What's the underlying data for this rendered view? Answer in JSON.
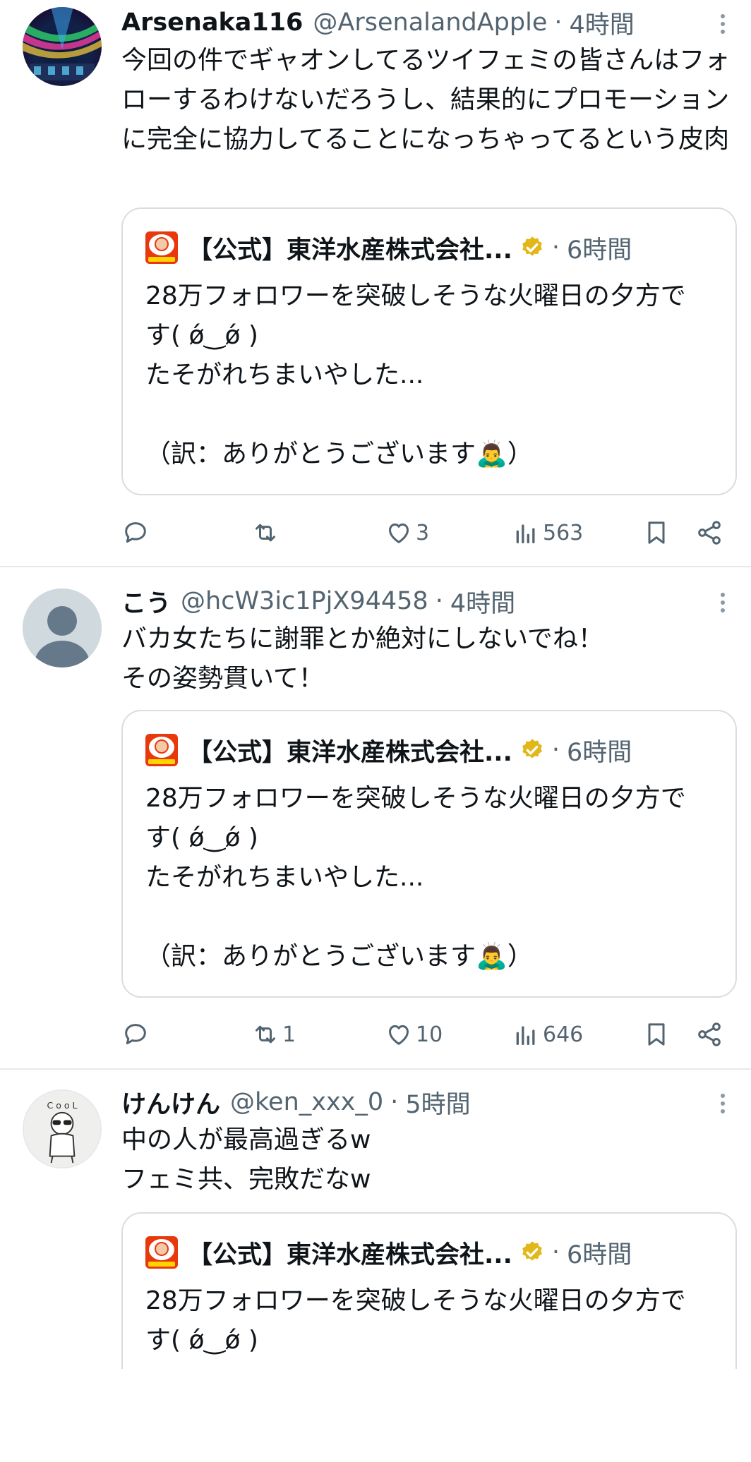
{
  "tweets": [
    {
      "name": "Arsenaka116",
      "handle": "@ArsenalandApple",
      "time": "4時間",
      "text": "今回の件でギャオンしてるツイフェミの皆さんはフォローするわけないだろうし、結果的にプロモーションに完全に協力してることになっちゃってるという皮肉",
      "avatar_icon": "neon-photo-avatar",
      "quote": {
        "name": "【公式】東洋水産株式会社...",
        "time": "6時間",
        "text": "28万フォロワーを突破しそうな火曜日の夕方です( ǿ‿ǿ )\nたそがれちまいやした...\n\n（訳：ありがとうございます🙇‍♂️）"
      },
      "replies": "",
      "retweets": "",
      "likes": "3",
      "views": "563"
    },
    {
      "name": "こう",
      "handle": "@hcW3ic1PjX94458",
      "time": "4時間",
      "text": "バカ女たちに謝罪とか絶対にしないでね！\nその姿勢貫いて！",
      "avatar_icon": "default-user-avatar",
      "quote": {
        "name": "【公式】東洋水産株式会社...",
        "time": "6時間",
        "text": "28万フォロワーを突破しそうな火曜日の夕方です( ǿ‿ǿ )\nたそがれちまいやした...\n\n（訳：ありがとうございます🙇‍♂️）"
      },
      "replies": "",
      "retweets": "1",
      "likes": "10",
      "views": "646"
    },
    {
      "name": "けんけん",
      "handle": "@ken_xxx_0",
      "time": "5時間",
      "text": "中の人が最高過ぎるw\nフェミ共、完敗だなw",
      "avatar_icon": "cartoon-sunglasses-avatar",
      "quote": {
        "name": "【公式】東洋水産株式会社...",
        "time": "6時間",
        "text": "28万フォロワーを突破しそうな火曜日の夕方です( ǿ‿ǿ )"
      }
    }
  ],
  "colors": {
    "text": "#0f1419",
    "secondary": "#536471",
    "border": "#d9dde1",
    "verified_gold": "#e2b719",
    "brand_red": "#e8380d"
  }
}
